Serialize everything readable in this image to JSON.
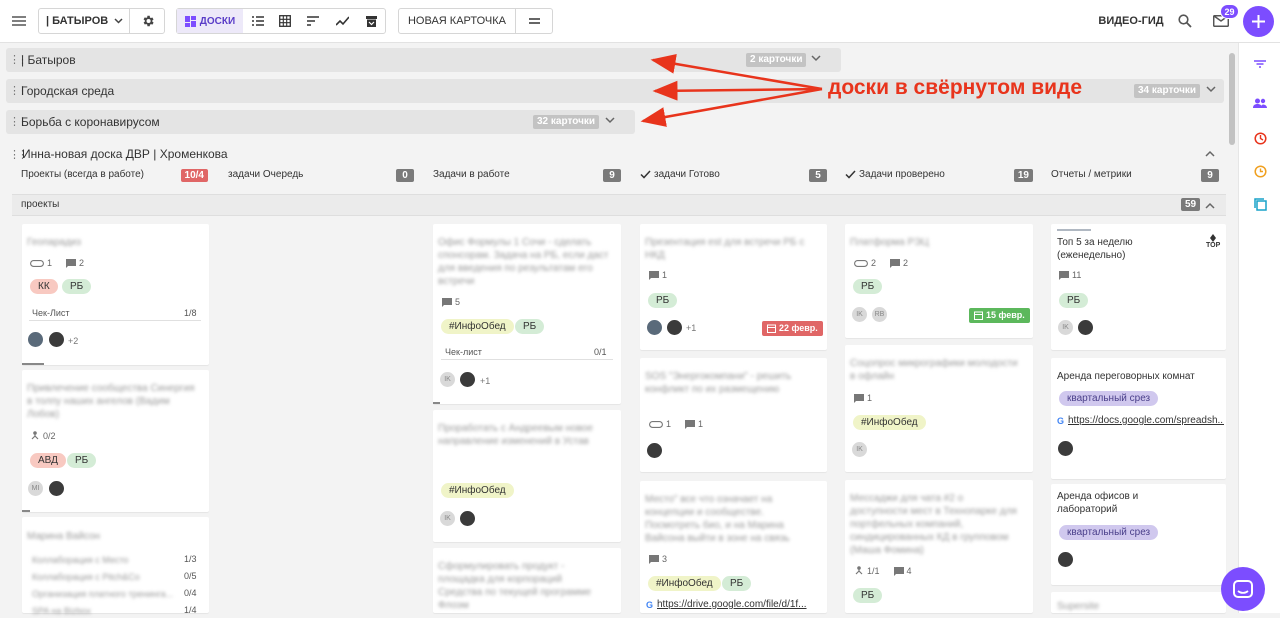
{
  "topbar": {
    "user_label": "| БАТЫРОВ",
    "view_boards": "ДОСКИ",
    "new_card": "НОВАЯ КАРТОЧКА",
    "video_guide": "ВИДЕО-ГИД",
    "mail_count": "29",
    "icons": [
      "hamburger-icon",
      "chevron-down-icon",
      "gear-icon",
      "boards-icon",
      "list-icon",
      "table-icon",
      "sort-icon",
      "chart-line-icon",
      "archive-icon",
      "menu-lines-icon",
      "search-icon",
      "mail-icon",
      "plus-icon"
    ]
  },
  "collapsed_boards": [
    {
      "name": "| Батыров",
      "count": "2 карточки"
    },
    {
      "name": "Городская среда",
      "count": "34 карточки"
    },
    {
      "name": "Борьба с коронавирусом",
      "count": "32 карточки"
    }
  ],
  "board": {
    "title": "Инна-новая доска ДВР | Хроменкова",
    "columns": [
      {
        "title": "Проекты (всегда в работе)",
        "count": "10/4",
        "count_color": "#e06666"
      },
      {
        "title": "задачи Очередь",
        "count": "0"
      },
      {
        "title": "Задачи в работе",
        "count": "9"
      },
      {
        "title": "задачи Готово",
        "count": "5"
      },
      {
        "title": "Задачи проверено",
        "count": "19"
      },
      {
        "title": "Отчеты / метрики",
        "count": "9"
      }
    ],
    "swimlane": {
      "title": "проекты",
      "count": "59"
    }
  },
  "cards": {
    "c1a": {
      "title": "Геопарадиз",
      "m1": "1",
      "m2": "2",
      "tags": [
        "КК",
        "РБ"
      ],
      "checklist": "Чек-Лист",
      "checklist_count": "1/8",
      "plus": "+2"
    },
    "c1b": {
      "title": "Привлечение сообщества Синергия в толпу наших ангелов (Вадим Лобов)",
      "sub": "0/2",
      "tags": [
        "АВД",
        "РБ"
      ]
    },
    "c1c": {
      "title": "Марина Вайсон",
      "lines": [
        "Коллаборация с Место",
        "Коллаборация с Pitch&Co",
        "Организация платного тренинга...",
        "SPA на Bizbox"
      ],
      "nums": [
        "1/3",
        "0/5",
        "0/4",
        "1/4"
      ]
    },
    "c3a": {
      "title": "Офис Формулы 1 Сочи - сделать спонсорам. Задача на РБ, если даст для введения по результатам его встречи",
      "m": "5",
      "tags": [
        "#ИнфоОбед",
        "РБ"
      ],
      "checklist": "Чек-лист",
      "checklist_count": "0/1",
      "plus": "+1"
    },
    "c3b": {
      "title": "Проработать с Андреевым новое направление изменений в Устав",
      "tag": "#ИнфоОбед"
    },
    "c3c": {
      "title": "Сформулировать продукт - площадка для корпораций Средства по текущей программе Флоэм"
    },
    "c4a": {
      "title": "Презентация est для встречи РБ с НКД",
      "m": "1",
      "tag": "РБ",
      "plus": "+1",
      "date": "22 февр."
    },
    "c4b": {
      "title": "SOS \"Энергокомпани\" - решить конфликт по их размещению",
      "m1": "1",
      "m2": "1"
    },
    "c4c": {
      "title": "Место\" все что означает на концепции и сообществе. Посмотреть био, и на Марина Вайсона выйти в зоне на связь",
      "m": "3",
      "tags": [
        "#ИнфоОбед",
        "РБ"
      ],
      "link": "https://drive.google.com/file/d/1f..."
    },
    "c5a": {
      "title": "Платформа РЭЦ",
      "m1": "2",
      "m2": "2",
      "tag": "РБ",
      "date": "15 февр."
    },
    "c5b": {
      "title": "Соцопрос микрографики молодости в офлайн",
      "m": "1",
      "tag": "#ИнфоОбед"
    },
    "c5c": {
      "title": "Мессаджи для чата #2 о доступности мест в Технопарке для портфельных компаний, синдицированных КД в групповом (Маша Фомина)",
      "sub": "1/1",
      "m": "4",
      "tag": "РБ"
    },
    "c6a": {
      "title": "Топ 5 за неделю (еженедельно)",
      "m": "11",
      "tag": "РБ",
      "top": "TOP"
    },
    "c6b": {
      "title": "Аренда переговорных комнат",
      "tag": "квартальный срез",
      "link": "https://docs.google.com/spreadsh..."
    },
    "c6c": {
      "title": "Аренда офисов и лабораторий",
      "tag": "квартальный срез"
    },
    "c6d": {
      "title": "Supersite"
    }
  },
  "annotation": "доски в свёрнутом виде",
  "colors": {
    "accent": "#7c4dff",
    "annotation": "#e8341c",
    "overdue": "#e06666",
    "ontime": "#5cb85c"
  }
}
